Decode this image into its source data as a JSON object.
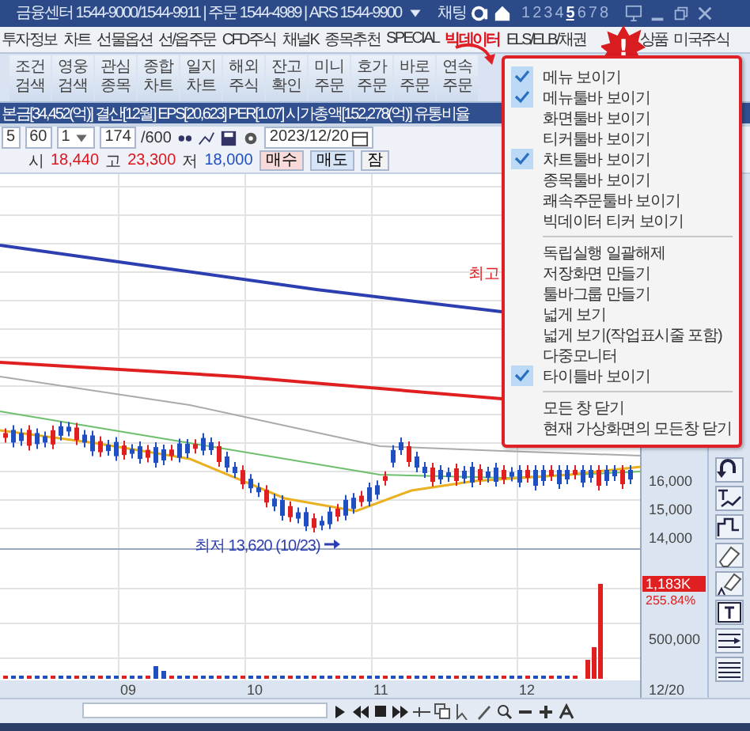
{
  "title_bar": {
    "info": "금융센터 1544-9000/1544-9911 | 주문 1544-4989 | ARS 1544-9900",
    "chat": "채팅",
    "screens": [
      {
        "label": "1",
        "selected": false
      },
      {
        "label": "2",
        "selected": false
      },
      {
        "label": "3",
        "selected": false
      },
      {
        "label": "4",
        "selected": false
      },
      {
        "label": "5",
        "selected": true
      },
      {
        "label": "6",
        "selected": false
      },
      {
        "label": "7",
        "selected": false
      },
      {
        "label": "8",
        "selected": false
      }
    ]
  },
  "menu_bar": [
    {
      "label": "투자정보",
      "highlighted": false
    },
    {
      "label": "차트",
      "highlighted": false
    },
    {
      "label": "선물옵션",
      "highlighted": false
    },
    {
      "label": "선/옵주문",
      "highlighted": false
    },
    {
      "label": "CFD주식",
      "highlighted": false
    },
    {
      "label": "채널K",
      "highlighted": false
    },
    {
      "label": "종목추천",
      "highlighted": false
    },
    {
      "label": "SPECIAL",
      "highlighted": false
    },
    {
      "label": "빅데이터",
      "highlighted": true
    },
    {
      "label": "ELS/ELB/채권",
      "highlighted": false
    },
    {
      "label": "상품",
      "highlighted": false
    },
    {
      "label": "미국주식",
      "highlighted": false
    }
  ],
  "toolbar": [
    "조건 검색",
    "영웅 검색",
    "관심 종목",
    "종합 차트",
    "일지 차트",
    "해외 주식",
    "잔고 확인",
    "미니 주문",
    "호가 주문",
    "바로 주문",
    "연속 주문"
  ],
  "info_line": "본금[34,452(억)] 결산[12월] EPS[20,623] PER[1.07] 시가총액[152,278(억)] 유통비율",
  "chart_toolbar": {
    "period": "5",
    "interval": "60",
    "unit": "1",
    "count": "174",
    "total": "/600",
    "date": "2023/12/20"
  },
  "price_line": {
    "items": [
      {
        "label": "시",
        "value": "18,440",
        "color": "#e0141e"
      },
      {
        "label": "고",
        "value": "23,300",
        "color": "#e0141e"
      },
      {
        "label": "저",
        "value": "18,000",
        "color": "#1f4fc0"
      }
    ],
    "buttons": [
      "매수",
      "매도",
      "잠"
    ]
  },
  "chart": {
    "high_label": "최고",
    "low_label": "최저 13,620 (10/23)",
    "price_ticks": [
      "16,000",
      "15,000",
      "14,000"
    ],
    "volume_badge": "1,183K",
    "volume_change": "255.84%",
    "volume_tick": "500,000",
    "date_labels": [
      "09",
      "10",
      "11",
      "12"
    ],
    "current_date": "12/20"
  },
  "alert_badge": "!",
  "context_menu": {
    "items": [
      {
        "kind": "item",
        "label": "메뉴 보이기",
        "checked": true
      },
      {
        "kind": "item",
        "label": "메뉴툴바 보이기",
        "checked": true
      },
      {
        "kind": "item",
        "label": "화면툴바 보이기",
        "checked": false
      },
      {
        "kind": "item",
        "label": "티커툴바 보이기",
        "checked": false
      },
      {
        "kind": "item",
        "label": "차트툴바 보이기",
        "checked": true
      },
      {
        "kind": "item",
        "label": "종목툴바 보이기",
        "checked": false
      },
      {
        "kind": "item",
        "label": "쾌속주문툴바 보이기",
        "checked": false
      },
      {
        "kind": "item",
        "label": "빅데이터 티커 보이기",
        "checked": false
      },
      {
        "kind": "separator"
      },
      {
        "kind": "item",
        "label": "독립실행 일괄해제",
        "checked": false
      },
      {
        "kind": "item",
        "label": "저장화면 만들기",
        "checked": false
      },
      {
        "kind": "item",
        "label": "툴바그룹 만들기",
        "checked": false
      },
      {
        "kind": "item",
        "label": "넓게 보기",
        "checked": false
      },
      {
        "kind": "item",
        "label": "넓게 보기(작업표시줄 포함)",
        "checked": false
      },
      {
        "kind": "item",
        "label": "다중모니터",
        "checked": false
      },
      {
        "kind": "item",
        "label": "타이틀바 보이기",
        "checked": true
      },
      {
        "kind": "separator"
      },
      {
        "kind": "item",
        "label": "모든 창 닫기",
        "checked": false
      },
      {
        "kind": "item",
        "label": "현재 가상화면의 모든창 닫기",
        "checked": false
      }
    ]
  }
}
